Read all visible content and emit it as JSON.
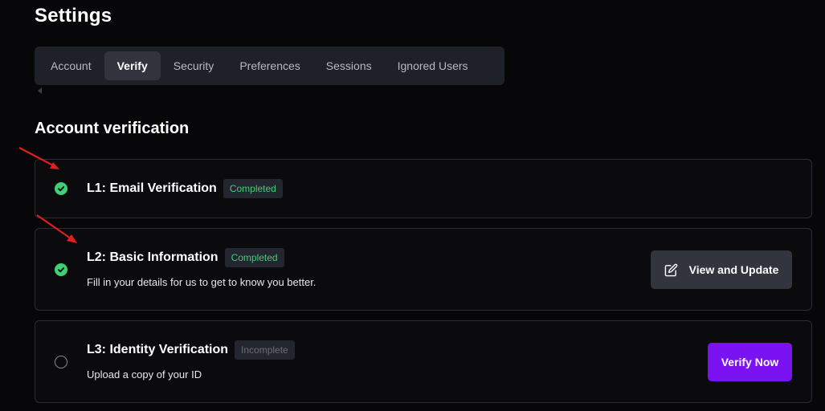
{
  "page": {
    "title": "Settings"
  },
  "tabs": [
    {
      "label": "Account",
      "active": false
    },
    {
      "label": "Verify",
      "active": true
    },
    {
      "label": "Security",
      "active": false
    },
    {
      "label": "Preferences",
      "active": false
    },
    {
      "label": "Sessions",
      "active": false
    },
    {
      "label": "Ignored Users",
      "active": false
    }
  ],
  "section": {
    "title": "Account verification"
  },
  "levels": [
    {
      "title": "L1: Email Verification",
      "status": "Completed",
      "description": ""
    },
    {
      "title": "L2: Basic Information",
      "status": "Completed",
      "description": "Fill in your details for us to get to know you better.",
      "action": "View and Update"
    },
    {
      "title": "L3: Identity Verification",
      "status": "Incomplete",
      "description": "Upload a copy of your ID",
      "action": "Verify Now"
    }
  ],
  "colors": {
    "background": "#070709",
    "completed": "#3fcf77",
    "accent": "#7b12f1",
    "annotation_arrow": "#e01e1e"
  },
  "icons": {
    "check": "check-circle-icon",
    "edit": "edit-icon",
    "pending": "empty-circle-icon"
  }
}
